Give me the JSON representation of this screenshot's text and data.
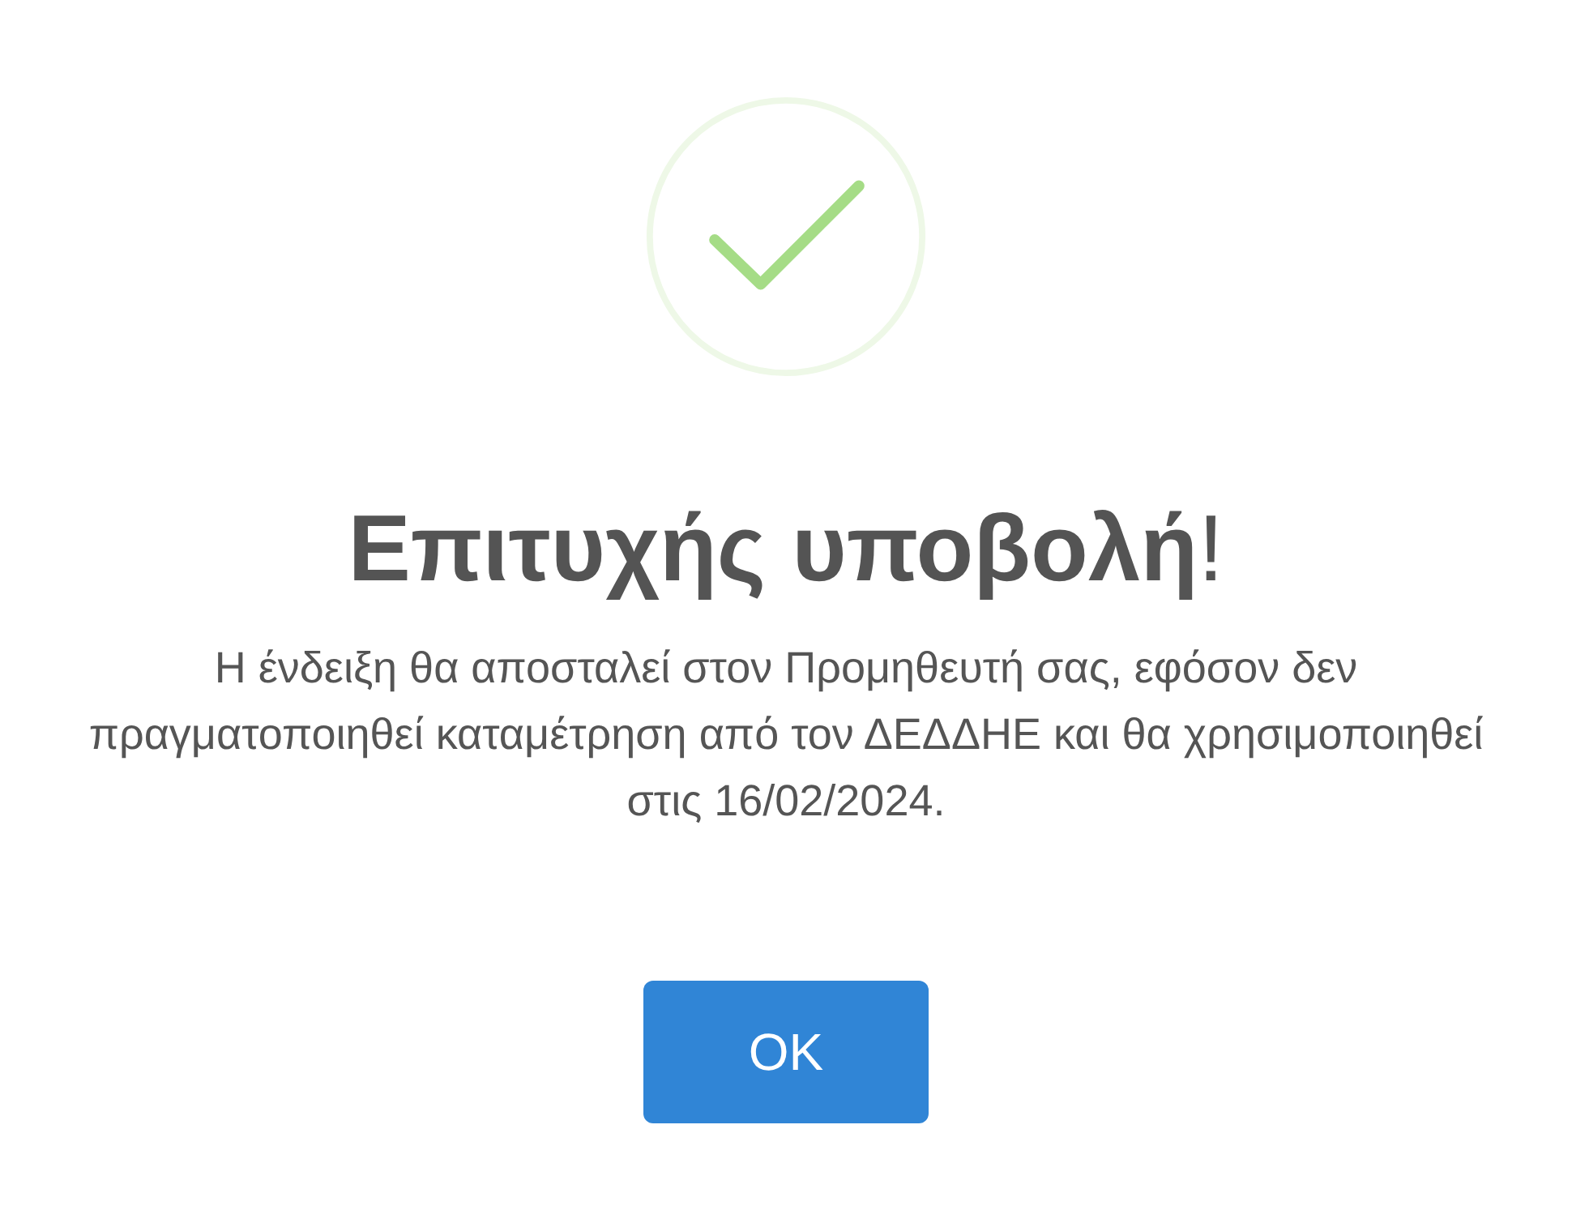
{
  "dialog": {
    "icon": {
      "kind": "success"
    },
    "title": "**Επιτυχής υποβολή**!",
    "message": "Η ένδειξη θα αποσταλεί στον Προμηθευτή σας, εφόσον δεν πραγματοποιηθεί καταμέτρηση από τον ΔΕΔΔΗΕ και θα χρησιμοποιηθεί στις 16/02/2024.",
    "buttons": [
      {
        "label": "OK"
      }
    ]
  }
}
